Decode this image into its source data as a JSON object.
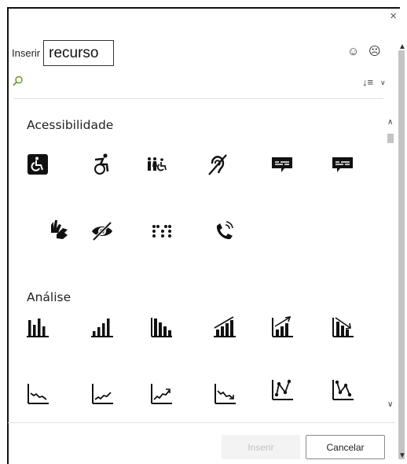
{
  "dialog": {
    "close_glyph": "×",
    "insert_label": "Inserir",
    "search_value": "recurso",
    "feedback_positive_glyph": "☺",
    "feedback_negative_glyph": "☹"
  },
  "categories": [
    {
      "title": "Acessibilidade",
      "icons": [
        "wheelchair-box-icon",
        "active-wheelchair-icon",
        "family-accessibility-icon",
        "hearing-impaired-icon",
        "closed-captions-icon",
        "captions-icon",
        "sign-language-icon",
        "low-vision-icon",
        "braille-icon",
        "volume-control-telephone-icon"
      ]
    },
    {
      "title": "Análise",
      "icons": [
        "bar-chart-icon",
        "bar-chart-ascending-icon",
        "bar-chart-descending-icon",
        "bar-chart-upward-trend-icon",
        "bar-chart-upward-arrow-icon",
        "bar-chart-downward-arrow-icon",
        "line-chart-downward-icon",
        "line-chart-upward-icon",
        "line-chart-upward-arrow-icon",
        "line-chart-downward-arrow-icon",
        "line-chart-points-up-icon",
        "line-chart-points-down-icon"
      ]
    }
  ],
  "footer": {
    "insert_button": "Inserir",
    "cancel_button": "Cancelar"
  }
}
